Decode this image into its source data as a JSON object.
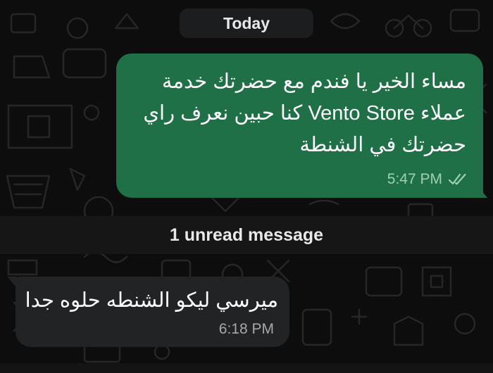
{
  "date_chip": {
    "label": "Today"
  },
  "outgoing_message": {
    "text": "مساء الخير يا فندم مع حضرتك خدمة عملاء Vento Store كنا حبين نعرف راي حضرتك في الشنطة",
    "time": "5:47 PM",
    "status_icon": "double-check-icon",
    "bubble_color": "#1f6f47"
  },
  "unread_divider": {
    "label": "1 unread message"
  },
  "incoming_message": {
    "text": "ميرسي ليكو الشنطه حلوه جدا",
    "time": "6:18 PM",
    "bubble_color": "#222324"
  },
  "wallpaper": {
    "style": "doodle-pattern-dark",
    "icon_color": "#2a2a2a"
  }
}
